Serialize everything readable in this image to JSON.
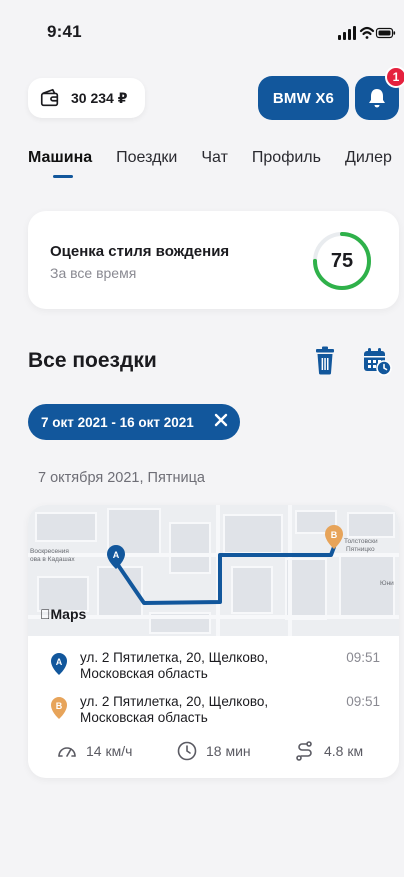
{
  "status_bar": {
    "time": "9:41"
  },
  "header": {
    "balance": "30 234 ₽",
    "car_label": "BMW X6",
    "notifications_count": "1"
  },
  "tabs": [
    {
      "label": "Машина",
      "active": true
    },
    {
      "label": "Поездки"
    },
    {
      "label": "Чат"
    },
    {
      "label": "Профиль"
    },
    {
      "label": "Дилер"
    }
  ],
  "score_card": {
    "title": "Оценка стиля вождения",
    "subtitle": "За все время",
    "score": "75",
    "score_color": "#2fb14a"
  },
  "trips": {
    "title": "Все поездки",
    "filter_chip": "7 окт 2021 - 16 окт 2021",
    "day_label": "7 октября 2021, Пятница",
    "trip": {
      "map_provider": "Maps",
      "map_labels": [
        "Воскресения",
        "ова в Кадашах",
        "Толстовски",
        "Пятницко",
        "Юни"
      ],
      "start": {
        "marker": "A",
        "address": "ул. 2 Пятилетка, 20, Щелково, Московская область",
        "time": "09:51"
      },
      "end": {
        "marker": "B",
        "address": "ул. 2 Пятилетка, 20, Щелково, Московская область",
        "time": "09:51"
      },
      "speed": "14 км/ч",
      "duration": "18 мин",
      "distance": "4.8 км"
    }
  },
  "colors": {
    "accent": "#12579c",
    "badge": "#e5213e",
    "pin_a": "#12579c",
    "pin_b": "#e7a45a"
  }
}
